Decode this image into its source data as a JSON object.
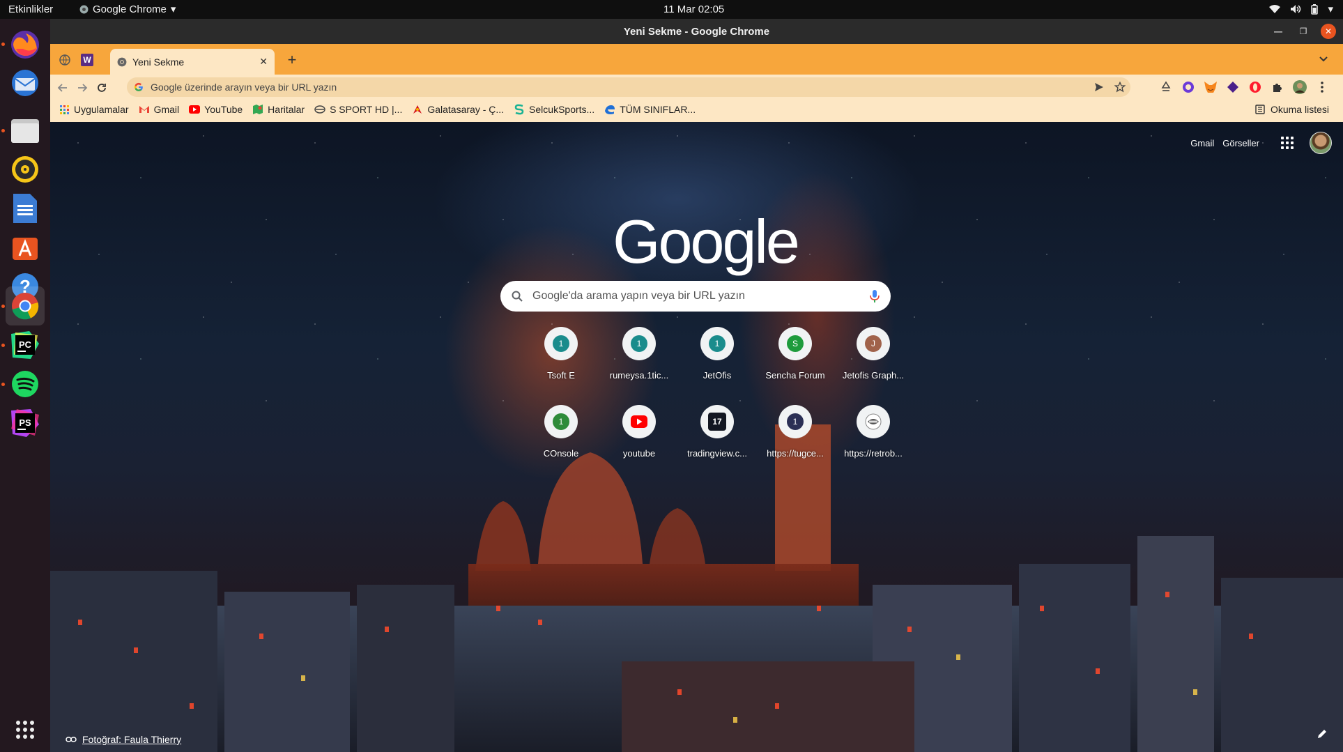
{
  "topbar": {
    "activities": "Etkinlikler",
    "app_name": "Google Chrome",
    "clock": "11 Mar  02:05"
  },
  "dock": {
    "apps": [
      {
        "name": "Firefox",
        "icon": "firefox-icon"
      },
      {
        "name": "Thunderbird",
        "icon": "thunderbird-icon"
      },
      {
        "name": "Files",
        "icon": "files-icon"
      },
      {
        "name": "Rhythmbox",
        "icon": "rhythmbox-icon"
      },
      {
        "name": "LibreOffice Writer",
        "icon": "writer-icon"
      },
      {
        "name": "Ubuntu Software",
        "icon": "software-icon"
      },
      {
        "name": "Help",
        "icon": "help-icon"
      },
      {
        "name": "Google Chrome",
        "icon": "chrome-icon"
      },
      {
        "name": "PyCharm",
        "icon": "pycharm-icon",
        "label": "PC"
      },
      {
        "name": "Spotify",
        "icon": "spotify-icon"
      },
      {
        "name": "PhpStorm",
        "icon": "phpstorm-icon",
        "label": "PS"
      }
    ],
    "show_apps_icon": "grid-icon"
  },
  "window": {
    "title": "Yeni Sekme - Google Chrome"
  },
  "tabs": {
    "active_label": "Yeni Sekme",
    "new_tab": "+",
    "pinned_letter": "W"
  },
  "omnibox": {
    "placeholder": "Google üzerinde arayın veya bir URL yazın"
  },
  "bookmarks": {
    "items": [
      {
        "label": "Uygulamalar",
        "icon": "apps-grid-icon"
      },
      {
        "label": "Gmail",
        "icon": "gmail-icon"
      },
      {
        "label": "YouTube",
        "icon": "youtube-icon"
      },
      {
        "label": "Haritalar",
        "icon": "maps-icon"
      },
      {
        "label": "S SPORT HD |...",
        "icon": "ssport-icon"
      },
      {
        "label": "Galatasaray - Ç...",
        "icon": "galatasaray-icon"
      },
      {
        "label": "SelcukSports...",
        "icon": "selcuk-icon"
      },
      {
        "label": "TÜM SINIFLAR...",
        "icon": "edge-icon"
      }
    ],
    "reading_list": "Okuma listesi"
  },
  "ntp": {
    "gmail": "Gmail",
    "images": "Görseller",
    "logo": "Google",
    "search_placeholder": "Google'da arama yapın veya bir URL yazın",
    "shortcuts": [
      {
        "label": "Tsoft E",
        "badge": "1",
        "color": "#1a8c8c"
      },
      {
        "label": "rumeysa.1tic...",
        "badge": "1",
        "color": "#1a8c8c"
      },
      {
        "label": "JetOfis",
        "badge": "1",
        "color": "#1a8c8c"
      },
      {
        "label": "Sencha Forum",
        "badge": "S",
        "color": "#1e9b3c"
      },
      {
        "label": "Jetofis Graph...",
        "badge": "J",
        "color": "#a0624a"
      },
      {
        "label": "COnsole",
        "badge": "1",
        "color": "#2e8b3a"
      },
      {
        "label": "youtube",
        "badge": "",
        "color": "#ff0000"
      },
      {
        "label": "tradingview.c...",
        "badge": "17",
        "color": "#131722"
      },
      {
        "label": "https://tugce...",
        "badge": "1",
        "color": "#2b2f55"
      },
      {
        "label": "https://retrob...",
        "badge": "",
        "color": "#888888"
      }
    ],
    "credit": "Fotoğraf: Faula Thierry"
  }
}
